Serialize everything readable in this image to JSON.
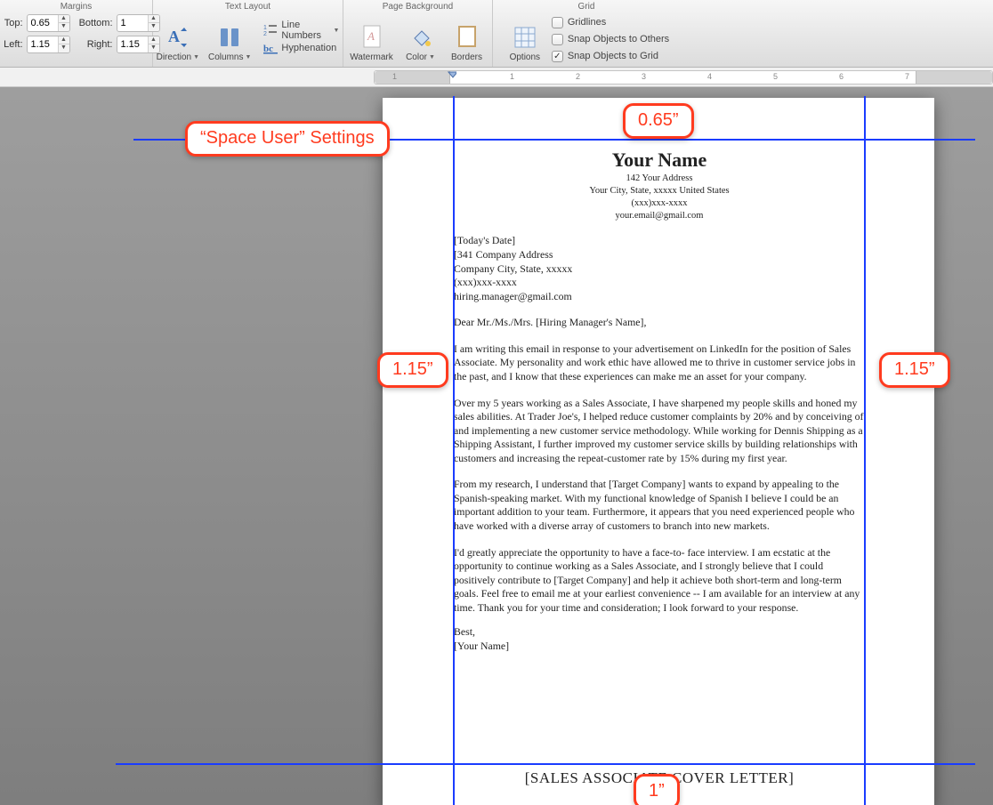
{
  "ribbon": {
    "groups": {
      "margins": {
        "title": "Margins",
        "top_label": "Top:",
        "bottom_label": "Bottom:",
        "left_label": "Left:",
        "right_label": "Right:",
        "top_value": "0.65",
        "bottom_value": "1",
        "left_value": "1.15",
        "right_value": "1.15"
      },
      "text_layout": {
        "title": "Text Layout",
        "direction": "Direction",
        "columns": "Columns",
        "line_numbers": "Line Numbers",
        "hyphenation": "Hyphenation"
      },
      "page_bg": {
        "title": "Page Background",
        "watermark": "Watermark",
        "color": "Color",
        "borders": "Borders"
      },
      "grid": {
        "title": "Grid",
        "options": "Options",
        "gridlines": "Gridlines",
        "snap_others": "Snap Objects to Others",
        "snap_grid": "Snap Objects to Grid",
        "gridlines_checked": false,
        "snap_others_checked": false,
        "snap_grid_checked": true
      }
    }
  },
  "ruler": {
    "numbers": [
      "1",
      "1",
      "2",
      "3",
      "4",
      "5",
      "6",
      "7"
    ]
  },
  "document": {
    "header": {
      "name": "Your Name",
      "address1": "142 Your Address",
      "address2": "Your City, State, xxxxx United States",
      "phone": "(xxx)xxx-xxxx",
      "email": "your.email@gmail.com"
    },
    "meta": {
      "date": "[Today's Date]",
      "company_addr": "[341 Company Address",
      "company_city": "Company City, State, xxxxx",
      "company_phone": "(xxx)xxx-xxxx",
      "hiring_email": "hiring.manager@gmail.com"
    },
    "salutation": "Dear Mr./Ms./Mrs. [Hiring Manager's Name],",
    "p1": "I am writing this email in response to your advertisement on LinkedIn for the position of Sales Associate. My personality and work ethic have allowed me to thrive in customer service jobs in the past, and I know that these experiences can make me an asset for your company.",
    "p2": "Over my 5 years working as a Sales Associate, I have sharpened my people skills and honed my sales abilities. At Trader Joe's, I helped reduce customer complaints by 20% and by conceiving of and implementing a new customer service methodology. While working for Dennis Shipping as a Shipping Assistant, I further improved my customer service skills by building relationships with customers and increasing the repeat-customer rate by 15% during my first year.",
    "p3": "From my research, I understand that [Target Company] wants to expand by appealing to the Spanish-speaking market. With my functional knowledge of Spanish I believe I could be an important addition to your team. Furthermore, it appears that you need experienced people who have worked with a diverse array of customers to branch into new markets.",
    "p4": "I'd greatly appreciate the opportunity to have a face-to- face interview. I am ecstatic at the opportunity to continue working as a Sales Associate, and I strongly believe that I could positively contribute to [Target Company] and help it achieve both short-term and long-term goals. Feel free to email me at your earliest convenience -- I am available for an interview at any time. Thank you for your time and consideration; I look forward to your response.",
    "closing": "Best,",
    "signature": "[Your Name]",
    "footer": "[SALES ASSOCIATE COVER LETTER]"
  },
  "annotations": {
    "space_user": "“Space User” Settings",
    "top_margin": "0.65”",
    "left_margin": "1.15”",
    "right_margin": "1.15”",
    "bottom_margin": "1”"
  },
  "guide_colors": {
    "line": "#1a3cff"
  }
}
